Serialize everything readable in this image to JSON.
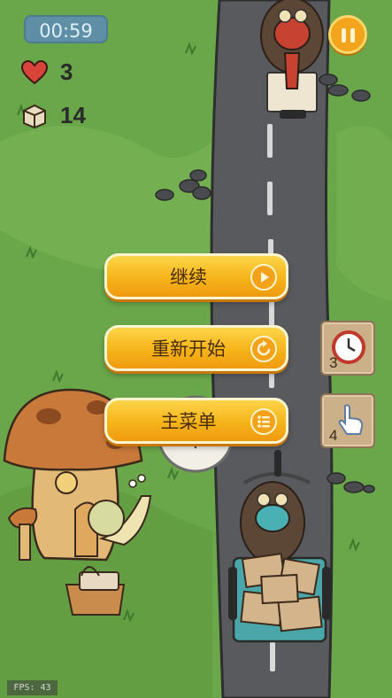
{
  "hud": {
    "timer": "00:59",
    "lives": "3",
    "packages": "14"
  },
  "pause_menu": {
    "continue_label": "继续",
    "restart_label": "重新开始",
    "main_menu_label": "主菜单"
  },
  "powerups": [
    {
      "icon": "clock-icon",
      "count": "3"
    },
    {
      "icon": "tap-hand-icon",
      "count": "4"
    }
  ],
  "fps": "FPS: 43",
  "colors": {
    "grass": "#6aa64a",
    "road": "#595a5e",
    "button_orange": "#f6b419",
    "timer_bg": "#5f8fa6"
  }
}
